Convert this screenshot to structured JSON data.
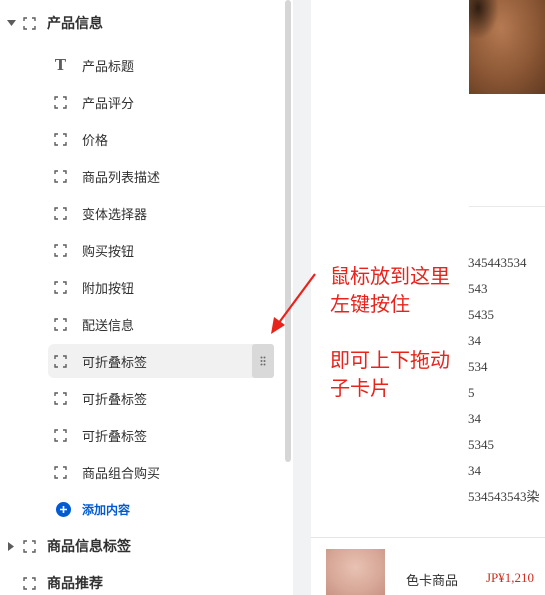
{
  "sidebar": {
    "sections": [
      {
        "label": "产品信息",
        "expanded": true
      },
      {
        "label": "商品信息标签",
        "expanded": false
      },
      {
        "label": "商品推荐",
        "expanded": false
      }
    ],
    "blocks": [
      {
        "label": "产品标题",
        "icon": "text-icon"
      },
      {
        "label": "产品评分",
        "icon": "bracket-icon"
      },
      {
        "label": "价格",
        "icon": "bracket-icon"
      },
      {
        "label": "商品列表描述",
        "icon": "bracket-icon"
      },
      {
        "label": "变体选择器",
        "icon": "bracket-icon"
      },
      {
        "label": "购买按钮",
        "icon": "bracket-icon"
      },
      {
        "label": "附加按钮",
        "icon": "bracket-icon"
      },
      {
        "label": "配送信息",
        "icon": "bracket-icon"
      },
      {
        "label": "可折叠标签",
        "icon": "bracket-icon",
        "active": true
      },
      {
        "label": "可折叠标签",
        "icon": "bracket-icon"
      },
      {
        "label": "可折叠标签",
        "icon": "bracket-icon"
      },
      {
        "label": "商品组合购买",
        "icon": "bracket-icon"
      }
    ],
    "add_content_label": "添加内容"
  },
  "preview": {
    "description_lines": [
      "345443534",
      "543",
      "5435",
      "34",
      "534",
      "5",
      "34",
      "5345",
      "34",
      "534543543染"
    ],
    "sticky_bar": {
      "title": "色卡商品",
      "price": "JP¥1,210"
    }
  },
  "annotation": {
    "line1": "鼠标放到这里",
    "line2": "左键按住",
    "line3": "即可上下拖动",
    "line4": "子卡片"
  },
  "colors": {
    "accent": "#005bd3",
    "annotation": "#e8231b",
    "price": "#d12b1f"
  }
}
